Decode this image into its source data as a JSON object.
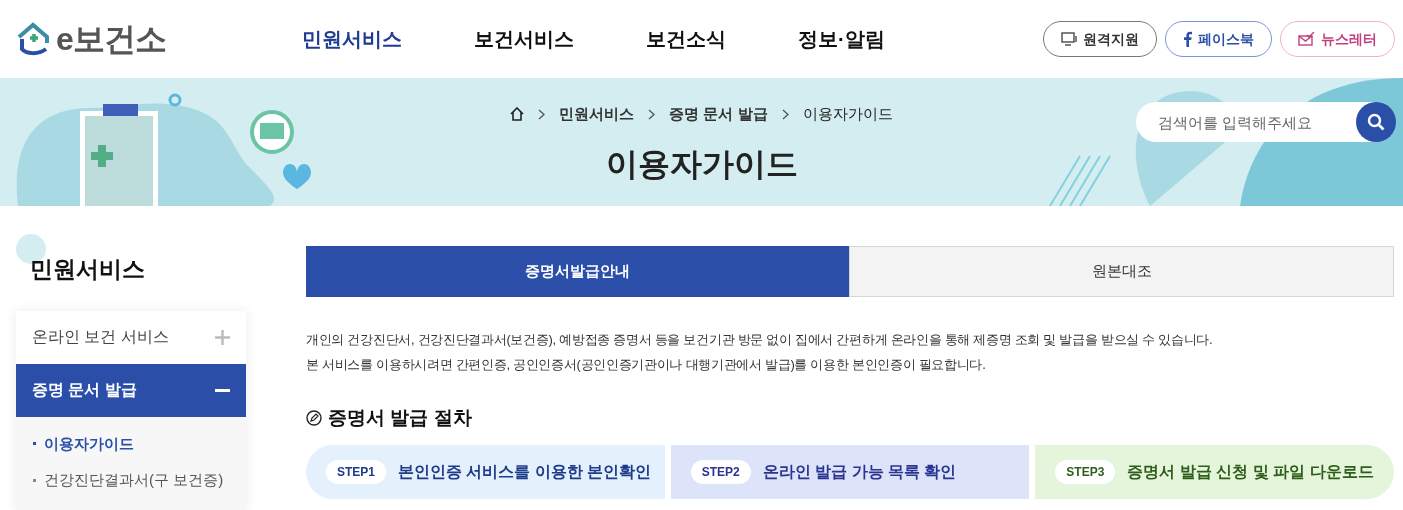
{
  "header": {
    "logo": "e보건소",
    "nav": [
      {
        "label": "민원서비스",
        "selected": true
      },
      {
        "label": "보건서비스",
        "selected": false
      },
      {
        "label": "보건소식",
        "selected": false
      },
      {
        "label": "정보·알림",
        "selected": false
      }
    ],
    "buttons": [
      {
        "kind": "remote",
        "label": "원격지원"
      },
      {
        "kind": "facebook",
        "label": "페이스북"
      },
      {
        "kind": "newsletter",
        "label": "뉴스레터"
      }
    ]
  },
  "banner": {
    "breadcrumb": [
      "민원서비스",
      "증명 문서 발급",
      "이용자가이드"
    ],
    "title": "이용자가이드",
    "search": {
      "placeholder": "검색어를 입력해주세요"
    }
  },
  "sidebar": {
    "title": "민원서비스",
    "items": [
      {
        "label": "온라인 보건 서비스",
        "expanded": false
      },
      {
        "label": "증명 문서 발급",
        "expanded": true,
        "children": [
          {
            "label": "이용자가이드",
            "selected": true
          },
          {
            "label": "건강진단결과서(구 보건증)",
            "selected": false
          }
        ]
      }
    ]
  },
  "tabs": [
    {
      "label": "증명서발급안내",
      "selected": true
    },
    {
      "label": "원본대조",
      "selected": false
    }
  ],
  "intro": [
    "개인의 건강진단서, 건강진단결과서(보건증), 예방접종 증명서 등을 보건기관 방문 없이 집에서 간편하게 온라인을 통해 제증명 조회 및 발급을 받으실 수 있습니다.",
    "본 서비스를 이용하시려면 간편인증, 공인인증서(공인인증기관이나 대행기관에서 발급)를 이용한 본인인증이 필요합니다."
  ],
  "procedure": {
    "title": "증명서 발급 절차",
    "steps": [
      {
        "badge": "STEP1",
        "label": "본인인증 서비스를 이용한 본인확인",
        "color": "#1e3a8a"
      },
      {
        "badge": "STEP2",
        "label": "온라인 발급 가능 목록 확인",
        "color": "#2a3592"
      },
      {
        "badge": "STEP3",
        "label": "증명서 발급 신청 및 파일 다운로드",
        "color": "#2e5e1a"
      }
    ]
  }
}
